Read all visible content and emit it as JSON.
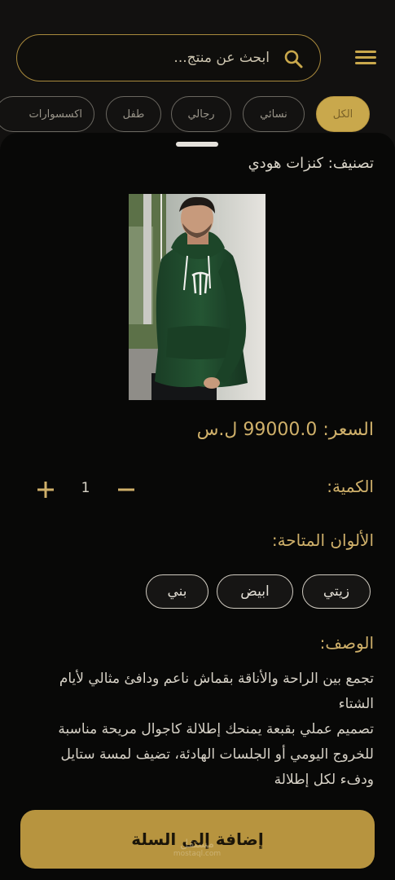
{
  "search": {
    "placeholder": "ابحث عن منتج..."
  },
  "filters": [
    {
      "label": "الكل",
      "active": true
    },
    {
      "label": "نسائي",
      "active": false
    },
    {
      "label": "رجالي",
      "active": false
    },
    {
      "label": "طفل",
      "active": false
    },
    {
      "label": "اكسسوارات",
      "active": false
    }
  ],
  "product": {
    "category": "تصنيف: كنزات هودي",
    "price": "السعر: 99000.0 ل.س",
    "quantity_label": "الكمية:",
    "quantity": "1",
    "colors_label": "الألوان المتاحة:",
    "colors": [
      "زيتي",
      "ابيض",
      "بني"
    ],
    "description_label": "الوصف:",
    "description": "تجمع بين الراحة والأناقة بقماش ناعم ودافئ مثالي لأيام الشتاء\nتصميم عملي بقبعة يمنحك إطلالة كاجوال مريحة مناسبة للخروج اليومي أو الجلسات الهادئة، تضيف لمسة ستايل ودفء لكل إطلالة"
  },
  "actions": {
    "add_to_cart": "إضافة إلى السلة"
  },
  "watermark": {
    "brand": "مستقل",
    "url": "mostaql.com"
  },
  "theme": {
    "accent": "#c9a84c",
    "background": "#121110",
    "sheet": "#080807",
    "hoodie": "#1f4a2d"
  }
}
